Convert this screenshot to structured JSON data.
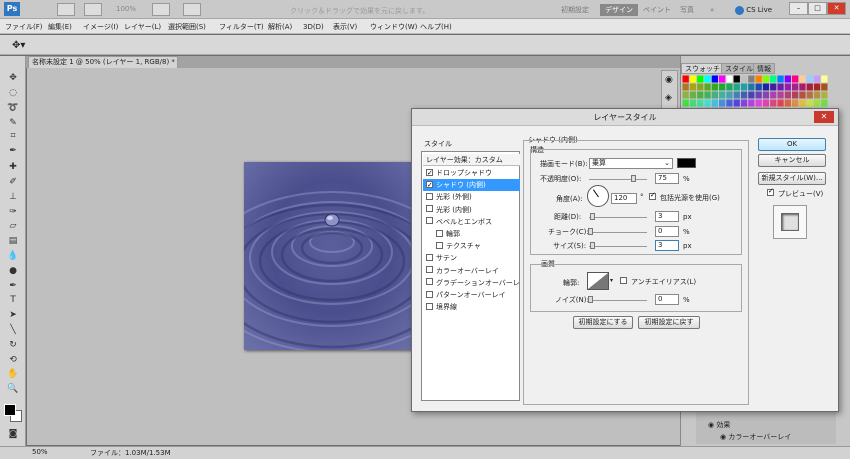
{
  "app": {
    "logo": "Ps",
    "zoom": "100%",
    "workspaces": [
      "初期設定",
      "デザイン",
      "ペイント",
      "写真"
    ],
    "active_workspace": "デザイン",
    "more": "»",
    "cslive": "CS Live",
    "window_buttons": [
      "–",
      "□",
      "✕"
    ]
  },
  "menu": [
    "ファイル(F)",
    "編集(E)",
    "イメージ(I)",
    "レイヤー(L)",
    "選択範囲(S)",
    "フィルター(T)",
    "解析(A)",
    "3D(D)",
    "表示(V)",
    "ウィンドウ(W)",
    "ヘルプ(H)"
  ],
  "options_bar": {
    "hint": "クリック＆ドラッグで効果を元に戻します。"
  },
  "document": {
    "tab_title": "名称未設定 1 @ 50% (レイヤー 1, RGB/8) *",
    "tab_close": "✕"
  },
  "status": {
    "zoom": "50%",
    "file": "ファイル：1.03M/1.53M"
  },
  "swatches": {
    "tabs": [
      "スウォッチ",
      "スタイル",
      "情報"
    ]
  },
  "dialog": {
    "title": "レイヤースタイル",
    "close": "✕",
    "list_header": "スタイル",
    "list_subheader": "レイヤー効果：カスタム",
    "items": [
      {
        "label": "ドロップシャドウ",
        "checked": true,
        "selected": false,
        "indent": false
      },
      {
        "label": "シャドウ (内側)",
        "checked": true,
        "selected": true,
        "indent": false
      },
      {
        "label": "光彩 (外側)",
        "checked": false,
        "selected": false,
        "indent": false
      },
      {
        "label": "光彩 (内側)",
        "checked": false,
        "selected": false,
        "indent": false
      },
      {
        "label": "ベベルとエンボス",
        "checked": false,
        "selected": false,
        "indent": false
      },
      {
        "label": "輪郭",
        "checked": false,
        "selected": false,
        "indent": true
      },
      {
        "label": "テクスチャ",
        "checked": false,
        "selected": false,
        "indent": true
      },
      {
        "label": "サテン",
        "checked": false,
        "selected": false,
        "indent": false
      },
      {
        "label": "カラーオーバーレイ",
        "checked": false,
        "selected": false,
        "indent": false
      },
      {
        "label": "グラデーションオーバーレイ",
        "checked": false,
        "selected": false,
        "indent": false
      },
      {
        "label": "パターンオーバーレイ",
        "checked": false,
        "selected": false,
        "indent": false
      },
      {
        "label": "境界線",
        "checked": false,
        "selected": false,
        "indent": false
      }
    ],
    "section_title": "シャドウ (内側)",
    "structure": {
      "title": "構造",
      "blend_mode_label": "描画モード(B):",
      "blend_mode": "乗算",
      "shadow_color": "#000000",
      "opacity_label": "不透明度(O):",
      "opacity": "75",
      "opacity_unit": "%",
      "angle_label": "角度(A):",
      "angle": "120",
      "angle_unit": "°",
      "global_light_label": "包括光源を使用(G)",
      "global_light": true,
      "distance_label": "距離(D):",
      "distance": "3",
      "distance_unit": "px",
      "choke_label": "チョーク(C):",
      "choke": "0",
      "choke_unit": "%",
      "size_label": "サイズ(S):",
      "size": "3",
      "size_unit": "px"
    },
    "quality": {
      "title": "画質",
      "contour_label": "輪郭:",
      "antialias_label": "アンチエイリアス(L)",
      "antialias": false,
      "noise_label": "ノイズ(N):",
      "noise": "0",
      "noise_unit": "%"
    },
    "make_default": "初期設定にする",
    "reset_default": "初期設定に戻す",
    "ok": "OK",
    "cancel": "キャンセル",
    "new_style": "新規スタイル(W)...",
    "preview_label": "プレビュー(V)",
    "preview": true
  },
  "layers": {
    "effects_label": "効果",
    "effect_item": "カラーオーバーレイ"
  },
  "colors": {
    "accent": "#3399ff",
    "ws_active": "#888888",
    "close_red": "#c8392b"
  }
}
